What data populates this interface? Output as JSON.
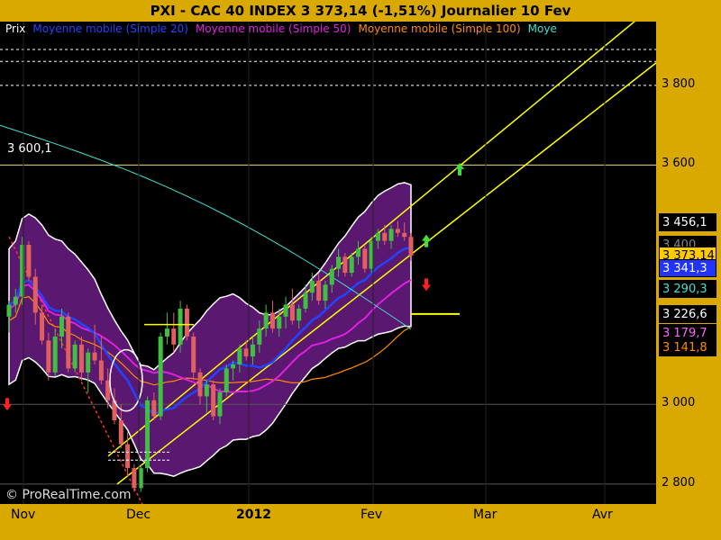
{
  "header": {
    "title": "PXI - CAC 40 INDEX     3 373,14 (-1,51%)     Journalier  10 Fev"
  },
  "legend": [
    {
      "label": "Prix",
      "color": "#ffffff"
    },
    {
      "label": "Moyenne mobile (Simple 20)",
      "color": "#2244ff"
    },
    {
      "label": "Moyenne mobile (Simple 50)",
      "color": "#e020e0"
    },
    {
      "label": "Moyenne mobile (Simple 100)",
      "color": "#ff8c00"
    },
    {
      "label": "Moye",
      "color": "#40e0d0"
    }
  ],
  "watermark": "© ProRealTime.com",
  "level_label": "3 600,1",
  "chart_data": {
    "type": "candlestick",
    "title": "PXI - CAC 40 INDEX",
    "subtitle": "3 373,14 (-1,51%)",
    "period": "Journalier",
    "date": "10 Fev",
    "ylim": [
      2750,
      3960
    ],
    "y_ticks": [
      {
        "value": 3800,
        "label": "3 800"
      },
      {
        "value": 3600,
        "label": "3 600"
      },
      {
        "value": 3000,
        "label": "3 000"
      },
      {
        "value": 2800,
        "label": "2 800"
      }
    ],
    "x_ticks": [
      "Nov",
      "Dec",
      "2012",
      "Fev",
      "Mar",
      "Avr"
    ],
    "value_boxes": [
      {
        "label": "3 456,1",
        "value": 3456.1,
        "bg": "#000000",
        "fg": "#ffffff"
      },
      {
        "label": "3 400",
        "value": 3400,
        "bg": "#000000",
        "fg": "#888888"
      },
      {
        "label": "3 373,14",
        "value": 3373.14,
        "bg": "#ffcc00",
        "fg": "#000000"
      },
      {
        "label": "3 341,3",
        "value": 3341.3,
        "bg": "#2233ff",
        "fg": "#ffffff"
      },
      {
        "label": "3 290,3",
        "value": 3290.3,
        "bg": "#000000",
        "fg": "#40e0d0"
      },
      {
        "label": "3 226,6",
        "value": 3226.6,
        "bg": "#000000",
        "fg": "#ffffff"
      },
      {
        "label": "3 179,7",
        "value": 3179.7,
        "bg": "#000000",
        "fg": "#ff66ff"
      },
      {
        "label": "3 141,8",
        "value": 3141.8,
        "bg": "#000000",
        "fg": "#ff8c00"
      }
    ],
    "horizontal_levels": [
      3600.1,
      3800,
      3860,
      3890,
      3226.6
    ],
    "candles": [
      [
        3220,
        3260,
        3180,
        3250
      ],
      [
        3250,
        3290,
        3230,
        3270
      ],
      [
        3270,
        3420,
        3250,
        3400
      ],
      [
        3400,
        3410,
        3310,
        3320
      ],
      [
        3320,
        3340,
        3200,
        3230
      ],
      [
        3230,
        3250,
        3150,
        3160
      ],
      [
        3160,
        3180,
        3060,
        3080
      ],
      [
        3080,
        3190,
        3070,
        3170
      ],
      [
        3170,
        3240,
        3140,
        3220
      ],
      [
        3220,
        3230,
        3080,
        3090
      ],
      [
        3090,
        3160,
        3080,
        3150
      ],
      [
        3150,
        3170,
        3060,
        3080
      ],
      [
        3080,
        3140,
        3030,
        3130
      ],
      [
        3130,
        3200,
        3100,
        3110
      ],
      [
        3110,
        3170,
        3050,
        3060
      ],
      [
        3060,
        3090,
        2990,
        3010
      ],
      [
        3010,
        3040,
        2950,
        2960
      ],
      [
        2960,
        3000,
        2890,
        2900
      ],
      [
        2900,
        2930,
        2820,
        2840
      ],
      [
        2840,
        2850,
        2780,
        2790
      ],
      [
        2790,
        2850,
        2780,
        2840
      ],
      [
        2840,
        3020,
        2830,
        3010
      ],
      [
        3010,
        3030,
        2960,
        2970
      ],
      [
        2970,
        3180,
        2960,
        3170
      ],
      [
        3170,
        3230,
        3150,
        3190
      ],
      [
        3190,
        3230,
        3130,
        3150
      ],
      [
        3150,
        3260,
        3130,
        3240
      ],
      [
        3240,
        3250,
        3160,
        3170
      ],
      [
        3170,
        3180,
        3060,
        3080
      ],
      [
        3080,
        3090,
        3000,
        3020
      ],
      [
        3020,
        3060,
        2980,
        3050
      ],
      [
        3050,
        3060,
        2960,
        2970
      ],
      [
        2970,
        3040,
        2950,
        3030
      ],
      [
        3030,
        3100,
        3020,
        3090
      ],
      [
        3090,
        3110,
        3060,
        3100
      ],
      [
        3100,
        3150,
        3080,
        3140
      ],
      [
        3140,
        3160,
        3110,
        3120
      ],
      [
        3120,
        3170,
        3100,
        3150
      ],
      [
        3150,
        3210,
        3130,
        3190
      ],
      [
        3190,
        3250,
        3170,
        3230
      ],
      [
        3230,
        3260,
        3180,
        3190
      ],
      [
        3190,
        3240,
        3170,
        3220
      ],
      [
        3220,
        3270,
        3190,
        3250
      ],
      [
        3250,
        3290,
        3200,
        3210
      ],
      [
        3210,
        3250,
        3190,
        3240
      ],
      [
        3240,
        3300,
        3230,
        3280
      ],
      [
        3280,
        3330,
        3260,
        3310
      ],
      [
        3310,
        3330,
        3250,
        3260
      ],
      [
        3260,
        3310,
        3240,
        3300
      ],
      [
        3300,
        3350,
        3280,
        3340
      ],
      [
        3340,
        3390,
        3320,
        3370
      ],
      [
        3370,
        3380,
        3320,
        3330
      ],
      [
        3330,
        3380,
        3320,
        3370
      ],
      [
        3370,
        3410,
        3350,
        3390
      ],
      [
        3390,
        3400,
        3330,
        3340
      ],
      [
        3340,
        3420,
        3330,
        3410
      ],
      [
        3410,
        3440,
        3390,
        3430
      ],
      [
        3430,
        3450,
        3400,
        3410
      ],
      [
        3410,
        3450,
        3390,
        3440
      ],
      [
        3440,
        3460,
        3420,
        3430
      ],
      [
        3430,
        3456,
        3410,
        3420
      ],
      [
        3420,
        3430,
        3360,
        3373
      ]
    ]
  }
}
